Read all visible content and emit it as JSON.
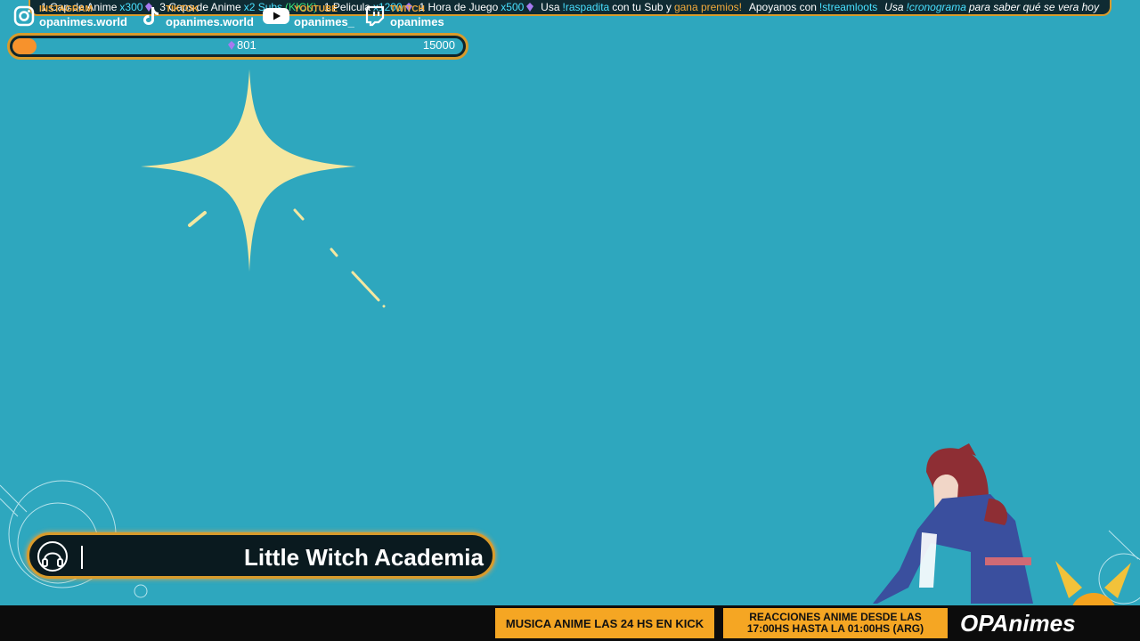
{
  "ticker": {
    "item1_text": "1 Cap de Anime",
    "item1_mult": "x300",
    "item2_text": "3 Caps de Anime",
    "item2_mult": "x2 Subs",
    "item2_extra": "(KICK)",
    "item3_text": "1 Pelicula",
    "item3_mult": "x1200",
    "item4_text": "1 Hora de Juego",
    "item4_mult": "x500",
    "item5_pre": "Usa",
    "item5_cmd": "!raspadita",
    "item5_mid": "con tu Sub y",
    "item5_prize": "gana premios!",
    "item6_pre": "Apoyanos con",
    "item6_cmd": "!streamloots",
    "item7_pre": "Usa",
    "item7_cmd": "!cronograma",
    "item7_post": "para saber qué se vera hoy"
  },
  "progress": {
    "current": "801",
    "goal": "15000",
    "fraction": 0.0534
  },
  "now_playing": {
    "title": "Little Witch Academia"
  },
  "socials": [
    {
      "platform": "INSTAGRAM",
      "handle": "opanimes.world",
      "icon": "instagram-icon"
    },
    {
      "platform": "TIKTOK",
      "handle": "opanimes.world",
      "icon": "tiktok-icon"
    },
    {
      "platform": "YOUTUBE",
      "handle": "opanimes_",
      "icon": "youtube-icon"
    },
    {
      "platform": "TWITCH",
      "handle": "opanimes",
      "icon": "twitch-icon"
    }
  ],
  "banner1": "MUSICA ANIME LAS 24 HS EN KICK",
  "banner2_line1": "REACCIONES ANIME DESDE LAS",
  "banner2_line2": "17:00HS HASTA LA 01:00HS (ARG)",
  "brand": "OPAnimes",
  "colors": {
    "background": "#2ea7be",
    "accent_gold": "#d89b2b",
    "accent_orange": "#f7922c",
    "highlight_cyan": "#49e0ff",
    "highlight_green": "#38e07a",
    "bar_dark": "#0c0c0c"
  }
}
